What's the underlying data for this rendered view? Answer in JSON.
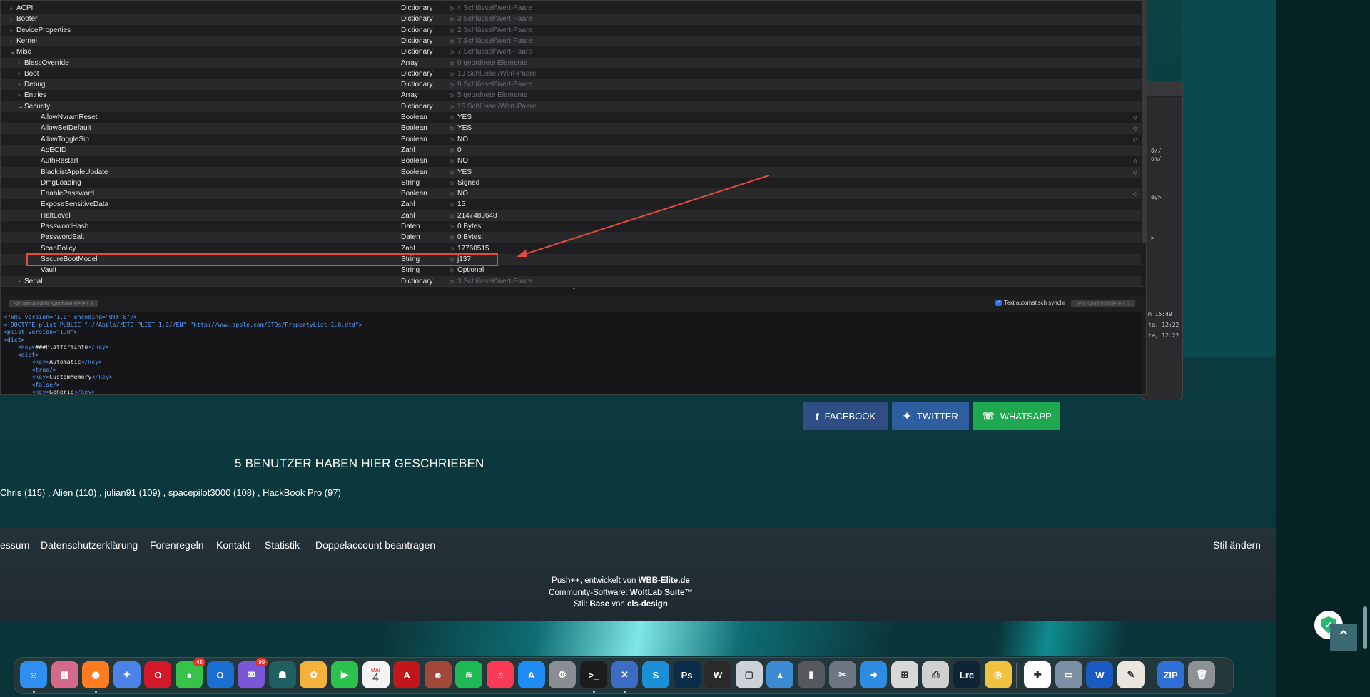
{
  "plist_editor": {
    "tree_rows": [
      {
        "key": "ACPI",
        "type": "Dictionary",
        "value": "4 Schlüssel/Wert-Paare",
        "muted": true,
        "level": 0,
        "disclosure": "›"
      },
      {
        "key": "Booter",
        "type": "Dictionary",
        "value": "3 Schlüssel/Wert-Paare",
        "muted": true,
        "level": 0,
        "disclosure": "›"
      },
      {
        "key": "DeviceProperties",
        "type": "Dictionary",
        "value": "2 Schlüssel/Wert-Paare",
        "muted": true,
        "level": 0,
        "disclosure": "›"
      },
      {
        "key": "Kernel",
        "type": "Dictionary",
        "value": "7 Schlüssel/Wert-Paare",
        "muted": true,
        "level": 0,
        "disclosure": "›"
      },
      {
        "key": "Misc",
        "type": "Dictionary",
        "value": "7 Schlüssel/Wert-Paare",
        "muted": true,
        "level": 0,
        "disclosure": "⌄"
      },
      {
        "key": "BlessOverride",
        "type": "Array",
        "value": "0 geordnete Elemente",
        "muted": true,
        "level": 1,
        "disclosure": "›"
      },
      {
        "key": "Boot",
        "type": "Dictionary",
        "value": "13 Schlüssel/Wert-Paare",
        "muted": true,
        "level": 1,
        "disclosure": "›"
      },
      {
        "key": "Debug",
        "type": "Dictionary",
        "value": "9 Schlüssel/Wert-Paare",
        "muted": true,
        "level": 1,
        "disclosure": "›"
      },
      {
        "key": "Entries",
        "type": "Array",
        "value": "5 geordnete Elemente",
        "muted": true,
        "level": 1,
        "disclosure": "›"
      },
      {
        "key": "Security",
        "type": "Dictionary",
        "value": "15 Schlüssel/Wert-Paare",
        "muted": true,
        "level": 1,
        "disclosure": "⌄"
      },
      {
        "key": "AllowNvramReset",
        "type": "Boolean",
        "value": "YES",
        "muted": false,
        "level": 2,
        "popup": true
      },
      {
        "key": "AllowSetDefault",
        "type": "Boolean",
        "value": "YES",
        "muted": false,
        "level": 2,
        "popup": true
      },
      {
        "key": "AllowToggleSip",
        "type": "Boolean",
        "value": "NO",
        "muted": false,
        "level": 2,
        "popup": true
      },
      {
        "key": "ApECID",
        "type": "Zahl",
        "value": "0",
        "muted": false,
        "level": 2
      },
      {
        "key": "AuthRestart",
        "type": "Boolean",
        "value": "NO",
        "muted": false,
        "level": 2,
        "popup": true
      },
      {
        "key": "BlacklistAppleUpdate",
        "type": "Boolean",
        "value": "YES",
        "muted": false,
        "level": 2,
        "popup": true
      },
      {
        "key": "DmgLoading",
        "type": "String",
        "value": "Signed",
        "muted": false,
        "level": 2
      },
      {
        "key": "EnablePassword",
        "type": "Boolean",
        "value": "NO",
        "muted": false,
        "level": 2,
        "popup": true
      },
      {
        "key": "ExposeSensitiveData",
        "type": "Zahl",
        "value": "15",
        "muted": false,
        "level": 2
      },
      {
        "key": "HaltLevel",
        "type": "Zahl",
        "value": "2147483648",
        "muted": false,
        "level": 2
      },
      {
        "key": "PasswordHash",
        "type": "Daten",
        "value": "0 Bytes:",
        "muted": false,
        "level": 2
      },
      {
        "key": "PasswordSalt",
        "type": "Daten",
        "value": "0 Bytes:",
        "muted": false,
        "level": 2
      },
      {
        "key": "ScanPolicy",
        "type": "Zahl",
        "value": "17760515",
        "muted": false,
        "level": 2
      },
      {
        "key": "SecureBootModel",
        "type": "String",
        "value": "j137",
        "muted": false,
        "level": 2,
        "highlighted": true
      },
      {
        "key": "Vault",
        "type": "String",
        "value": "Optional",
        "muted": false,
        "level": 2
      },
      {
        "key": "Serial",
        "type": "Dictionary",
        "value": "3 Schlüssel/Wert-Paare",
        "muted": true,
        "level": 1,
        "disclosure": "›"
      }
    ],
    "sync_structure_label": "Strukturansicht synchronisieren ⇧",
    "auto_sync_label": "Text automatisch synchr",
    "sync_text_label": "Text synchronisieren ⇩",
    "xml_lines": [
      {
        "indent": 0,
        "html": "<?xml version=\"1.0\" encoding=\"UTF-8\"?>"
      },
      {
        "indent": 0,
        "html": "<!DOCTYPE plist PUBLIC \"-//Apple//DTD PLIST 1.0//EN\" \"http://www.apple.com/DTDs/PropertyList-1.0.dtd\">"
      },
      {
        "indent": 0,
        "html": "<plist version=\"1.0\">"
      },
      {
        "indent": 0,
        "html": "<dict>"
      },
      {
        "indent": 1,
        "tag": "key",
        "text": "###PlatformInfo"
      },
      {
        "indent": 1,
        "html": "<dict>"
      },
      {
        "indent": 2,
        "tag": "key",
        "text": "Automatic"
      },
      {
        "indent": 2,
        "html": "<true/>"
      },
      {
        "indent": 2,
        "tag": "key",
        "text": "CustomMemory"
      },
      {
        "indent": 2,
        "html": "<false/>"
      },
      {
        "indent": 2,
        "tag": "key",
        "text": "Generic"
      }
    ]
  },
  "side_window": {
    "snippets": [
      "0//",
      "om/",
      "ey>",
      ">",
      "m 15:49",
      "te, 12:22",
      "te, 12:22"
    ]
  },
  "webpage": {
    "share_buttons": {
      "facebook": "FACEBOOK",
      "twitter": "TWITTER",
      "whatsapp": "WHATSAPP"
    },
    "writers_title": "5 BENUTZER HABEN HIER GESCHRIEBEN",
    "writers": [
      "Chris (115)",
      "Alien (110)",
      "julian91 (109)",
      "spacepilot3000 (108)",
      "HackBook Pro (97)"
    ],
    "footer_links": [
      "essum",
      "Datenschutzerklärung",
      "Forenregeln",
      "Kontakt",
      "Statistik",
      "Doppelaccount beantragen"
    ],
    "style_change": "Stil ändern",
    "credits": [
      {
        "plain": "Push++, entwickelt von ",
        "bold": "WBB-Elite.de"
      },
      {
        "plain": "Community-Software: ",
        "bold": "WoltLab Suite™"
      },
      {
        "plain": "Stil: ",
        "bold": "Base",
        "plain2": " von ",
        "bold2": "cls-design"
      }
    ]
  },
  "dock": {
    "apps": [
      {
        "name": "finder-icon",
        "label": "☺",
        "color": "#2f8ff0",
        "running": true
      },
      {
        "name": "launchpad-icon",
        "label": "▦",
        "color": "#d46a8a"
      },
      {
        "name": "firefox-icon",
        "label": "◉",
        "color": "#ff7b1f",
        "running": true
      },
      {
        "name": "safari-icon",
        "label": "✦",
        "color": "#4b82e8"
      },
      {
        "name": "opera-icon",
        "label": "O",
        "color": "#d3182a"
      },
      {
        "name": "messages-icon",
        "label": "●",
        "color": "#37c24a",
        "badge": "45"
      },
      {
        "name": "outlook-icon",
        "label": "O",
        "color": "#1a6fd1"
      },
      {
        "name": "mail-icon",
        "label": "✉",
        "color": "#7a57d6",
        "badge": "99"
      },
      {
        "name": "github-icon",
        "label": "☗",
        "color": "#1f5f5f"
      },
      {
        "name": "photos-icon",
        "label": "✿",
        "color": "#f4b23c"
      },
      {
        "name": "facetime-icon",
        "label": "▶",
        "color": "#2cc34c"
      },
      {
        "name": "calendar-icon",
        "label": "4",
        "color": "#f4f4f4",
        "sub": "MAI"
      },
      {
        "name": "acrobat-icon",
        "label": "A",
        "color": "#c0161c"
      },
      {
        "name": "portrait-app-icon",
        "label": "☻",
        "color": "#a4473b"
      },
      {
        "name": "spotify-icon",
        "label": "≋",
        "color": "#1db954"
      },
      {
        "name": "music-icon",
        "label": "♫",
        "color": "#fa3a55"
      },
      {
        "name": "app-store-icon",
        "label": "A",
        "color": "#1f8cf3"
      },
      {
        "name": "system-preferences-icon",
        "label": "⚙",
        "color": "#8a8d93"
      },
      {
        "name": "terminal-icon",
        "label": "&gt;_",
        "color": "#1c1c1c",
        "running": true
      },
      {
        "name": "xcode-icon",
        "label": "✕",
        "color": "#3c6cc4",
        "running": true
      },
      {
        "name": "scrivener-icon",
        "label": "S",
        "color": "#1b90d8"
      },
      {
        "name": "photoshop-icon",
        "label": "Ps",
        "color": "#0c2d4a"
      },
      {
        "name": "wordpress-icon",
        "label": "W",
        "color": "#2a2a2a"
      },
      {
        "name": "preview-icon",
        "label": "▢",
        "color": "#cdd2d8"
      },
      {
        "name": "affinity-icon",
        "label": "▲",
        "color": "#3d8ad4"
      },
      {
        "name": "cylinder-app-icon",
        "label": "▮",
        "color": "#55585c"
      },
      {
        "name": "tools-icon",
        "label": "✂",
        "color": "#6e7781"
      },
      {
        "name": "transmit-icon",
        "label": "➜",
        "color": "#2d8be0"
      },
      {
        "name": "opencore-icon",
        "label": "⊞",
        "color": "#d8d8d8"
      },
      {
        "name": "printer-icon",
        "label": "⎙",
        "color": "#d0d0d0"
      },
      {
        "name": "lightroom-classic-icon",
        "label": "Lrc",
        "color": "#0f2437"
      },
      {
        "name": "file-finder-icon",
        "label": "◎",
        "color": "#f0c040"
      },
      {
        "name": "color-app-icon",
        "label": "✚",
        "color": "#ffffff",
        "sep_before": true
      },
      {
        "name": "drive-icon",
        "label": "▭",
        "color": "#7d8fa5"
      },
      {
        "name": "word-icon",
        "label": "W",
        "color": "#1a5bc2"
      },
      {
        "name": "notes-doc-icon",
        "label": "✎",
        "color": "#e9e6de"
      },
      {
        "name": "archive-zip-icon",
        "label": "ZIP",
        "color": "#2f6fd6",
        "sep_before": true
      },
      {
        "name": "trash-icon",
        "label": "🗑",
        "color": "#8d9194"
      }
    ]
  }
}
